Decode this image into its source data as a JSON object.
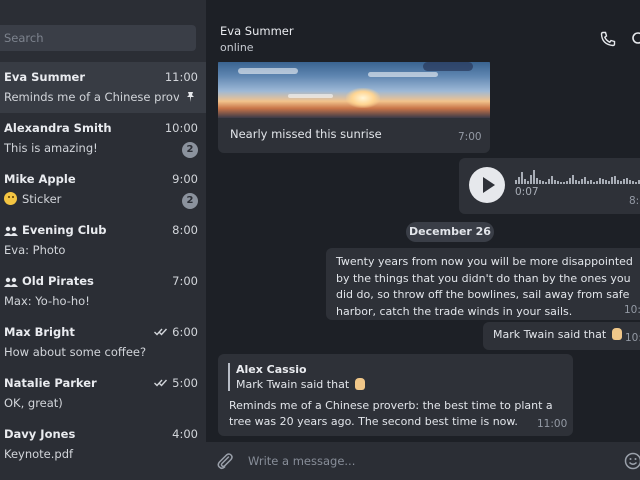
{
  "search": {
    "placeholder": "Search"
  },
  "chats": [
    {
      "name": "Eva Summer",
      "time": "11:00",
      "preview": "Reminds me of a Chinese prover...",
      "pinned": true
    },
    {
      "name": "Alexandra Smith",
      "time": "10:00",
      "preview": "This is amazing!",
      "unread": "2"
    },
    {
      "name": "Mike Apple",
      "time": "9:00",
      "preview": "Sticker",
      "unread": "2"
    },
    {
      "name": "Evening Club",
      "time": "8:00",
      "preview": "Eva: Photo",
      "group": true
    },
    {
      "name": "Old Pirates",
      "time": "7:00",
      "preview": "Max: Yo-ho-ho!",
      "group": true
    },
    {
      "name": "Max Bright",
      "time": "6:00",
      "preview": "How about some coffee?",
      "read": true
    },
    {
      "name": "Natalie Parker",
      "time": "5:00",
      "preview": "OK, great)",
      "read": true
    },
    {
      "name": "Davy Jones",
      "time": "4:00",
      "preview": "Keynote.pdf"
    }
  ],
  "header": {
    "name": "Eva Summer",
    "status": "online"
  },
  "messages": {
    "photo": {
      "caption": "Nearly missed this sunrise",
      "time": "7:00"
    },
    "voice": {
      "duration": "0:07",
      "time": "8:"
    },
    "date": "December 26",
    "quote": {
      "text": "Twenty years from now you will be more disappointed by the things that you didn't do than by the ones you did do, so throw off the bowlines, sail away from safe harbor, catch the trade winds in your sails.",
      "time": "10:"
    },
    "short": {
      "text": "Mark Twain said that",
      "time": "10:"
    },
    "reply": {
      "author": "Alex Cassio",
      "snippet": "Mark Twain said that",
      "text": "Reminds me of a Chinese proverb: the best time to plant a tree was 20 years ago. The second best time is now.",
      "time": "11:00"
    }
  },
  "composer": {
    "placeholder": "Write a message..."
  },
  "colors": {
    "background": "#1d2026",
    "sidebar": "#2b2e35",
    "bubble": "#2e3138",
    "active_chat": "#383c44"
  }
}
